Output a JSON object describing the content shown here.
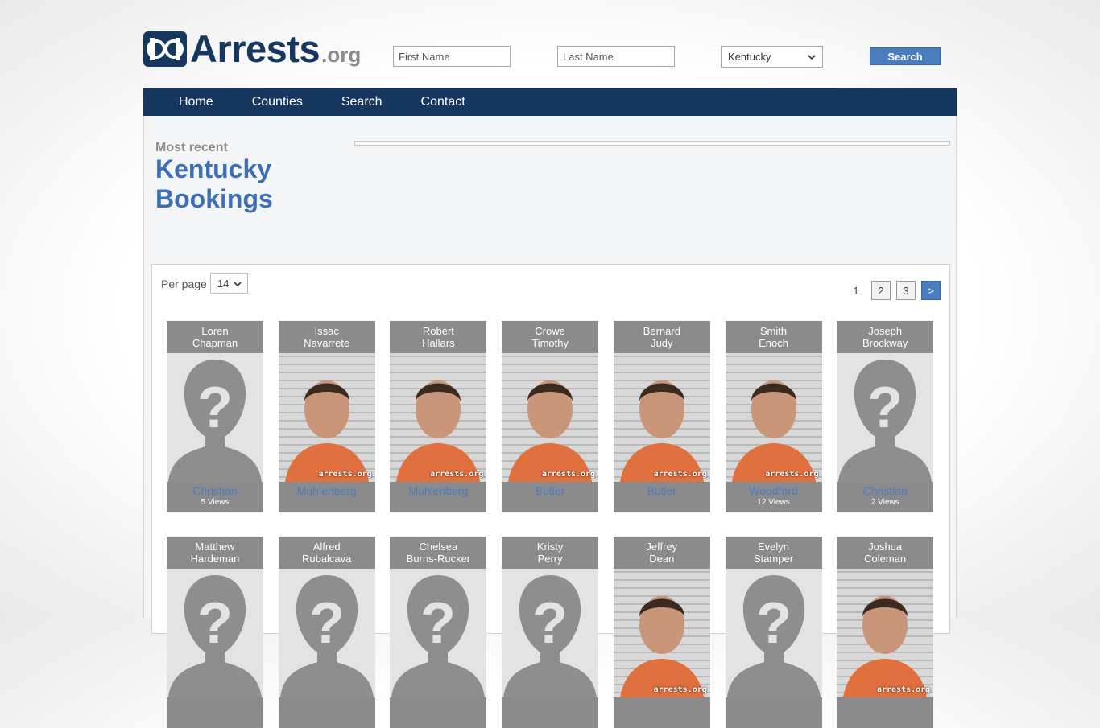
{
  "site": {
    "logo_text": "Arrests",
    "logo_suffix": ".org"
  },
  "search": {
    "first_placeholder": "First Name",
    "last_placeholder": "Last Name",
    "state_value": "Kentucky",
    "button_label": "Search"
  },
  "nav": {
    "items": [
      {
        "label": "Home"
      },
      {
        "label": "Counties"
      },
      {
        "label": "Search"
      },
      {
        "label": "Contact"
      }
    ]
  },
  "intro": {
    "subtitle": "Most recent",
    "title_line1": "Kentucky",
    "title_line2": "Bookings"
  },
  "listing": {
    "per_page_label": "Per page",
    "per_page_value": "14",
    "pages": [
      "1",
      "2",
      "3",
      ">"
    ],
    "current_page": "1",
    "watermark": "arrests.org",
    "cards": [
      {
        "first": "Loren",
        "last": "Chapman",
        "county": "Christian",
        "views": "5 Views",
        "photo": "placeholder"
      },
      {
        "first": "Issac",
        "last": "Navarrete",
        "county": "Muhlenberg",
        "views": "",
        "photo": "mugshot"
      },
      {
        "first": "Robert",
        "last": "Hallars",
        "county": "Muhlenberg",
        "views": "",
        "photo": "mugshot"
      },
      {
        "first": "Crowe",
        "last": "Timothy",
        "county": "Butler",
        "views": "",
        "photo": "mugshot"
      },
      {
        "first": "Bernard",
        "last": "Judy",
        "county": "Butler",
        "views": "",
        "photo": "mugshot"
      },
      {
        "first": "Smith",
        "last": "Enoch",
        "county": "Woodford",
        "views": "12 Views",
        "photo": "mugshot"
      },
      {
        "first": "Joseph",
        "last": "Brockway",
        "county": "Christian",
        "views": "2 Views",
        "photo": "placeholder"
      },
      {
        "first": "Matthew",
        "last": "Hardeman",
        "county": "",
        "views": "",
        "photo": "placeholder"
      },
      {
        "first": "Alfred",
        "last": "Rubalcava",
        "county": "",
        "views": "",
        "photo": "placeholder"
      },
      {
        "first": "Chelsea",
        "last": "Burns-Rucker",
        "county": "",
        "views": "",
        "photo": "placeholder"
      },
      {
        "first": "Kristy",
        "last": "Perry",
        "county": "",
        "views": "",
        "photo": "placeholder"
      },
      {
        "first": "Jeffrey",
        "last": "Dean",
        "county": "",
        "views": "",
        "photo": "mugshot"
      },
      {
        "first": "Evelyn",
        "last": "Stamper",
        "county": "",
        "views": "",
        "photo": "placeholder"
      },
      {
        "first": "Joshua",
        "last": "Coleman",
        "county": "",
        "views": "",
        "photo": "mugshot"
      }
    ]
  },
  "colors": {
    "brand": "#16375f",
    "accent": "#4a7cc0",
    "card_bg": "#8b8b8b"
  }
}
